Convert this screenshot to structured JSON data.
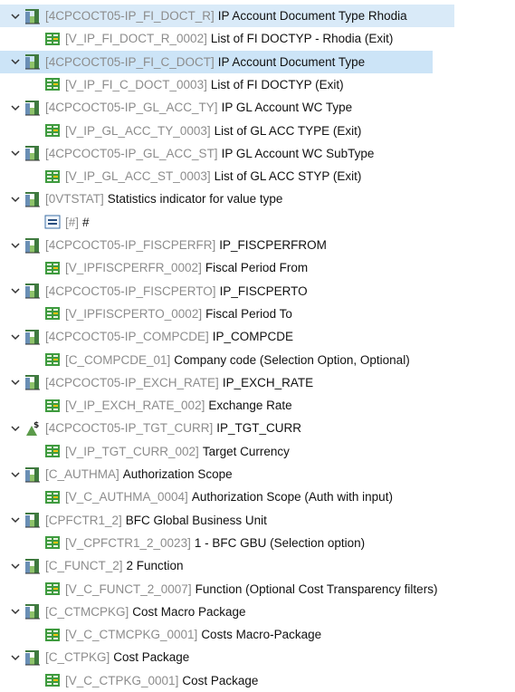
{
  "nodes": [
    {
      "type": "char",
      "tech": "[4CPCOCT05-IP_FI_DOCT_R]",
      "desc": "IP Account Document Type Rhodia",
      "selected": true,
      "child": {
        "tech": "[V_IP_FI_DOCT_R_0002]",
        "desc": "List of FI DOCTYP - Rhodia (Exit)"
      }
    },
    {
      "type": "char",
      "tech": "[4CPCOCT05-IP_FI_C_DOCT]",
      "desc": "IP Account Document Type",
      "hovered": true,
      "child": {
        "tech": "[V_IP_FI_C_DOCT_0003]",
        "desc": "List of FI DOCTYP (Exit)"
      }
    },
    {
      "type": "char",
      "tech": "[4CPCOCT05-IP_GL_ACC_TY]",
      "desc": "IP GL Account WC Type",
      "child": {
        "tech": "[V_IP_GL_ACC_TY_0003]",
        "desc": "List of GL ACC TYPE (Exit)"
      }
    },
    {
      "type": "char",
      "tech": "[4CPCOCT05-IP_GL_ACC_ST]",
      "desc": "IP GL Account WC SubType",
      "child": {
        "tech": "[V_IP_GL_ACC_ST_0003]",
        "desc": "List of GL ACC STYP (Exit)"
      }
    },
    {
      "type": "char",
      "tech": "[0VTSTAT]",
      "desc": "Statistics indicator for value type",
      "child": {
        "tech": "[#]",
        "desc": "#",
        "icon": "equals"
      }
    },
    {
      "type": "char",
      "tech": "[4CPCOCT05-IP_FISCPERFR]",
      "desc": "IP_FISCPERFROM",
      "child": {
        "tech": "[V_IPFISCPERFR_0002]",
        "desc": "Fiscal Period From"
      }
    },
    {
      "type": "char",
      "tech": "[4CPCOCT05-IP_FISCPERTO]",
      "desc": "IP_FISCPERTO",
      "child": {
        "tech": "[V_IPFISCPERTO_0002]",
        "desc": "Fiscal Period To"
      }
    },
    {
      "type": "char",
      "tech": "[4CPCOCT05-IP_COMPCDE]",
      "desc": "IP_COMPCDE",
      "child": {
        "tech": "[C_COMPCDE_01]",
        "desc": "Company code (Selection Option, Optional)"
      }
    },
    {
      "type": "char",
      "tech": "[4CPCOCT05-IP_EXCH_RATE]",
      "desc": "IP_EXCH_RATE",
      "child": {
        "tech": "[V_IP_EXCH_RATE_002]",
        "desc": "Exchange Rate"
      }
    },
    {
      "type": "currency",
      "tech": "[4CPCOCT05-IP_TGT_CURR]",
      "desc": "IP_TGT_CURR",
      "child": {
        "tech": "[V_IP_TGT_CURR_002]",
        "desc": "Target Currency"
      }
    },
    {
      "type": "char",
      "tech": "[C_AUTHMA]",
      "desc": "Authorization Scope",
      "child": {
        "tech": "[V_C_AUTHMA_0004]",
        "desc": "Authorization Scope  (Auth with input)"
      }
    },
    {
      "type": "char",
      "tech": "[CPFCTR1_2]",
      "desc": "BFC Global Business Unit",
      "child": {
        "tech": "[V_CPFCTR1_2_0023]",
        "desc": "1 - BFC GBU (Selection option)"
      }
    },
    {
      "type": "char",
      "tech": "[C_FUNCT_2]",
      "desc": "2 Function",
      "child": {
        "tech": "[V_C_FUNCT_2_0007]",
        "desc": "Function (Optional Cost Transparency filters)"
      }
    },
    {
      "type": "char",
      "tech": "[C_CTMCPKG]",
      "desc": "Cost Macro Package",
      "child": {
        "tech": "[V_C_CTMCPKG_0001]",
        "desc": "Costs Macro-Package"
      }
    },
    {
      "type": "char",
      "tech": "[C_CTPKG]",
      "desc": "Cost Package",
      "child": {
        "tech": "[V_C_CTPKG_0001]",
        "desc": "Cost Package"
      }
    }
  ]
}
